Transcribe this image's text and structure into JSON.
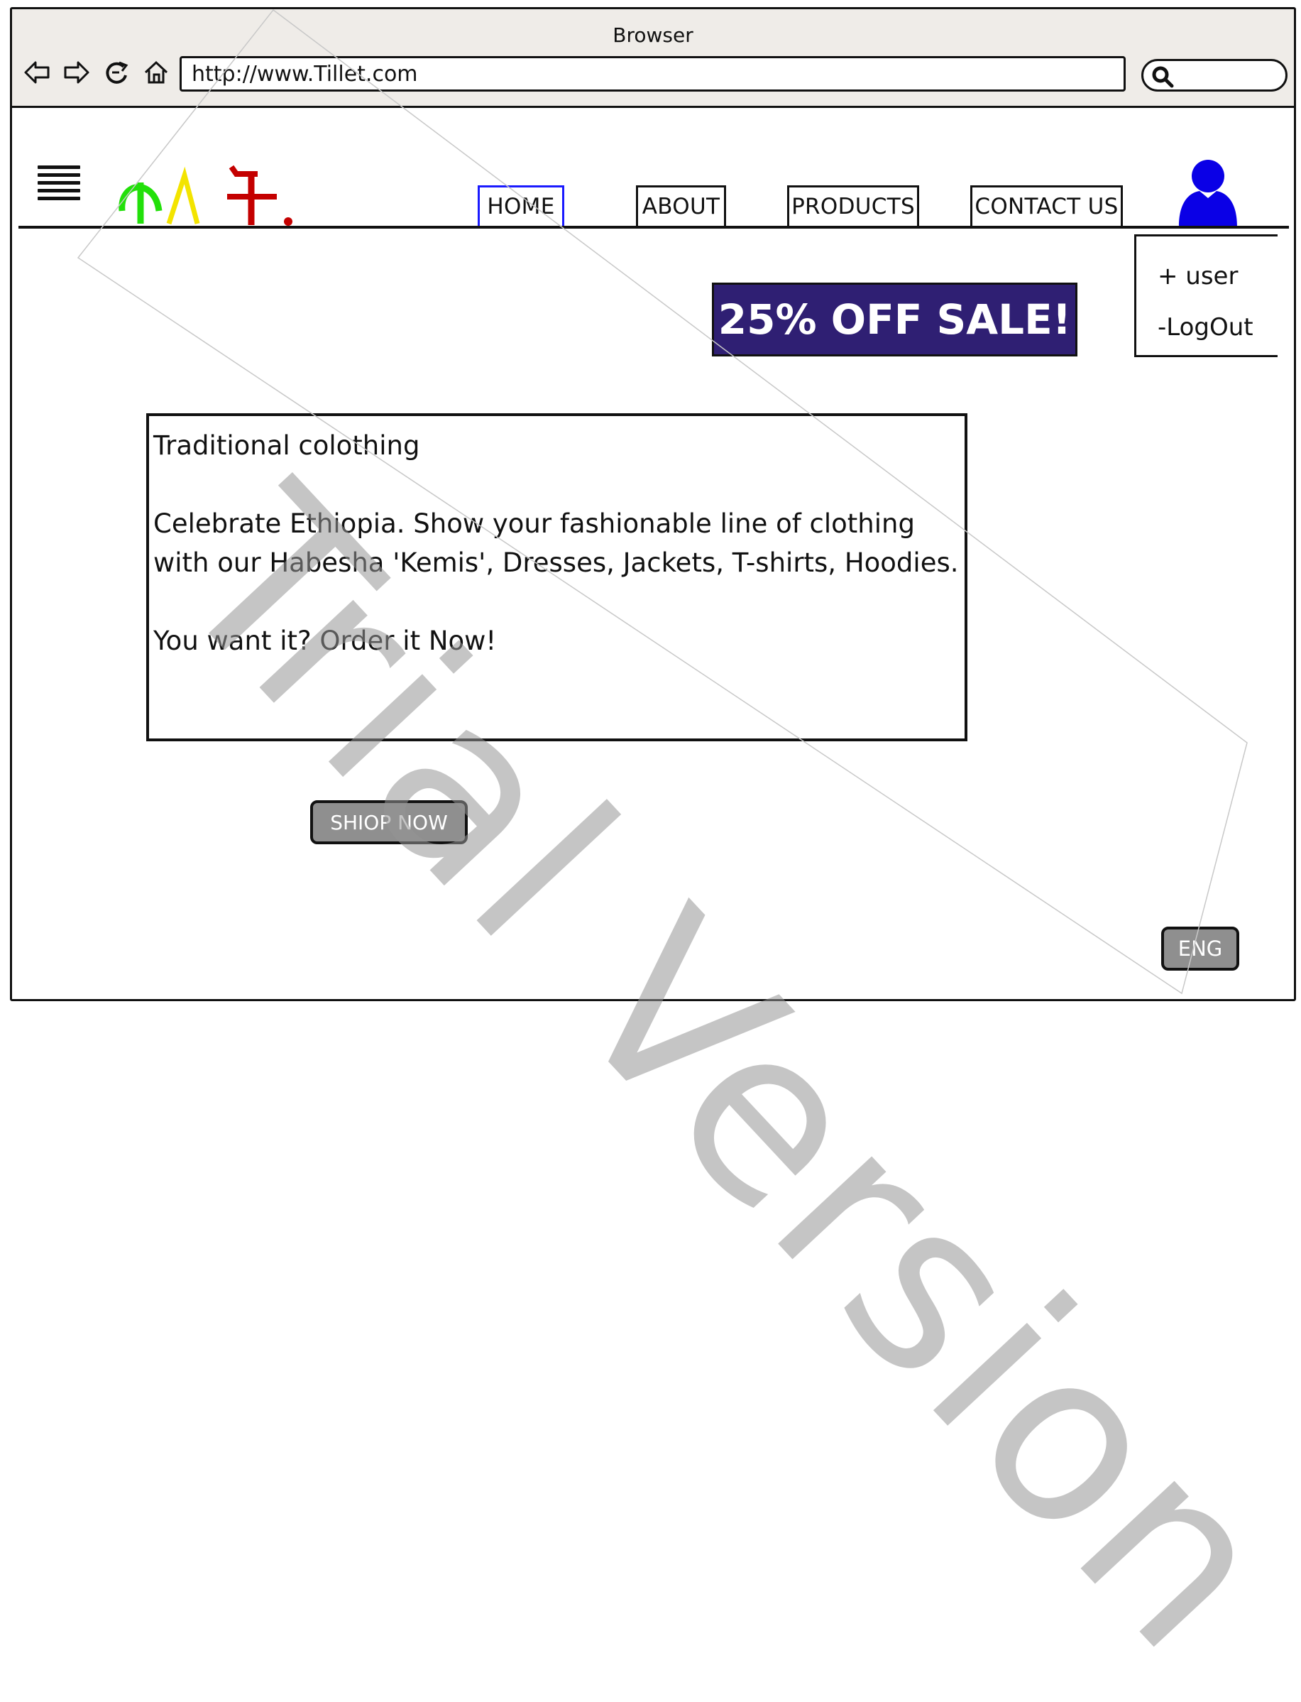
{
  "browser": {
    "title": "Browser",
    "url": "http://www.Tillet.com",
    "search_placeholder": ""
  },
  "header": {
    "logo_alt": "ጥለት.",
    "nav": [
      {
        "label": "HOME",
        "active": true
      },
      {
        "label": "ABOUT",
        "active": false
      },
      {
        "label": "PRODUCTS",
        "active": false
      },
      {
        "label": "CONTACT US",
        "active": false
      }
    ]
  },
  "user_menu": {
    "add_user": "+ user",
    "logout": "-LogOut"
  },
  "promo": {
    "sale_text": "25% OFF SALE!"
  },
  "content": {
    "title": "Traditional colothing",
    "line1": "Celebrate Ethiopia. Show your fashionable line of clothing",
    "line2": "with our Habesha 'Kemis', Dresses, Jackets, T-shirts, Hoodies.",
    "line3": "You want it? Order it Now!"
  },
  "actions": {
    "shop_label": "SHIOP NOW",
    "lang_label": "ENG"
  },
  "watermark": "Trial Version",
  "colors": {
    "active_tab": "#1a1aff",
    "sale_bg": "#2f1f73",
    "avatar": "#0a00e6",
    "button_bg": "#8f8f8f"
  }
}
